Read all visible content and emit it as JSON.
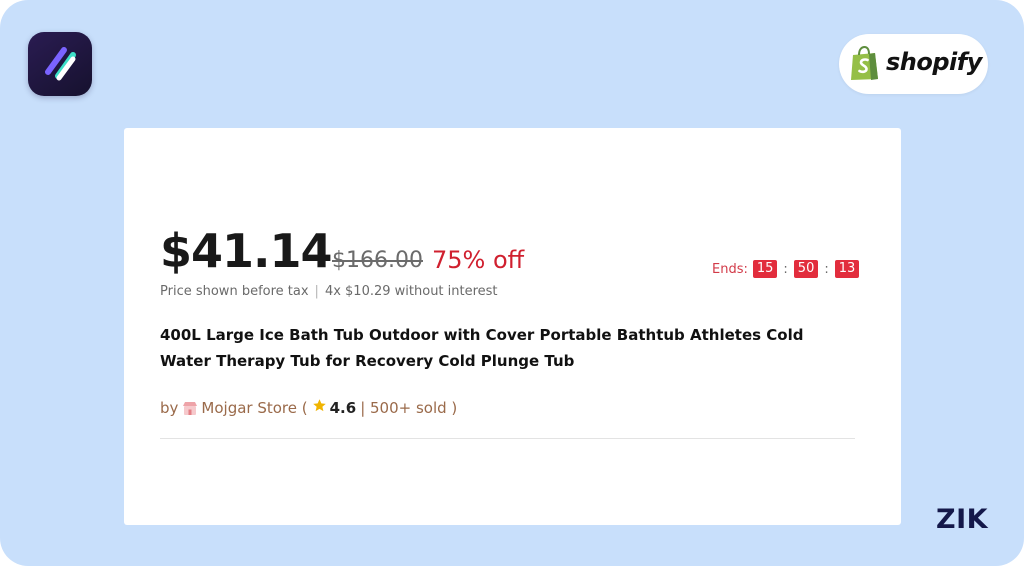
{
  "brand": {
    "app_logo_icon": "slash-stripes-logo",
    "shopify_icon": "shopify-bag-icon",
    "shopify_wordmark": "shopify",
    "footer_mark": "ZIK",
    "background_color": "#c8dffb"
  },
  "product": {
    "price_current": "$41.14",
    "price_original": "$166.00",
    "discount": "75% off",
    "tax_note": "Price shown before tax",
    "installments": "4x $10.29 without interest",
    "title": "400L Large Ice Bath Tub Outdoor with Cover Portable Bathtub Athletes Cold Water Therapy Tub for Recovery Cold Plunge Tub",
    "seller_prefix": "by",
    "store_icon": "store-icon",
    "store_name": "Mojgar Store (",
    "rating_icon": "star-icon",
    "rating": "4.6",
    "sold": "| 500+ sold )"
  },
  "countdown": {
    "label": "Ends:",
    "hours": "15",
    "minutes": "50",
    "seconds": "13",
    "separator": ":"
  },
  "colors": {
    "sale_red": "#d0202f",
    "countdown_red": "#e22d3d",
    "shopify_green": "#95bf47"
  }
}
